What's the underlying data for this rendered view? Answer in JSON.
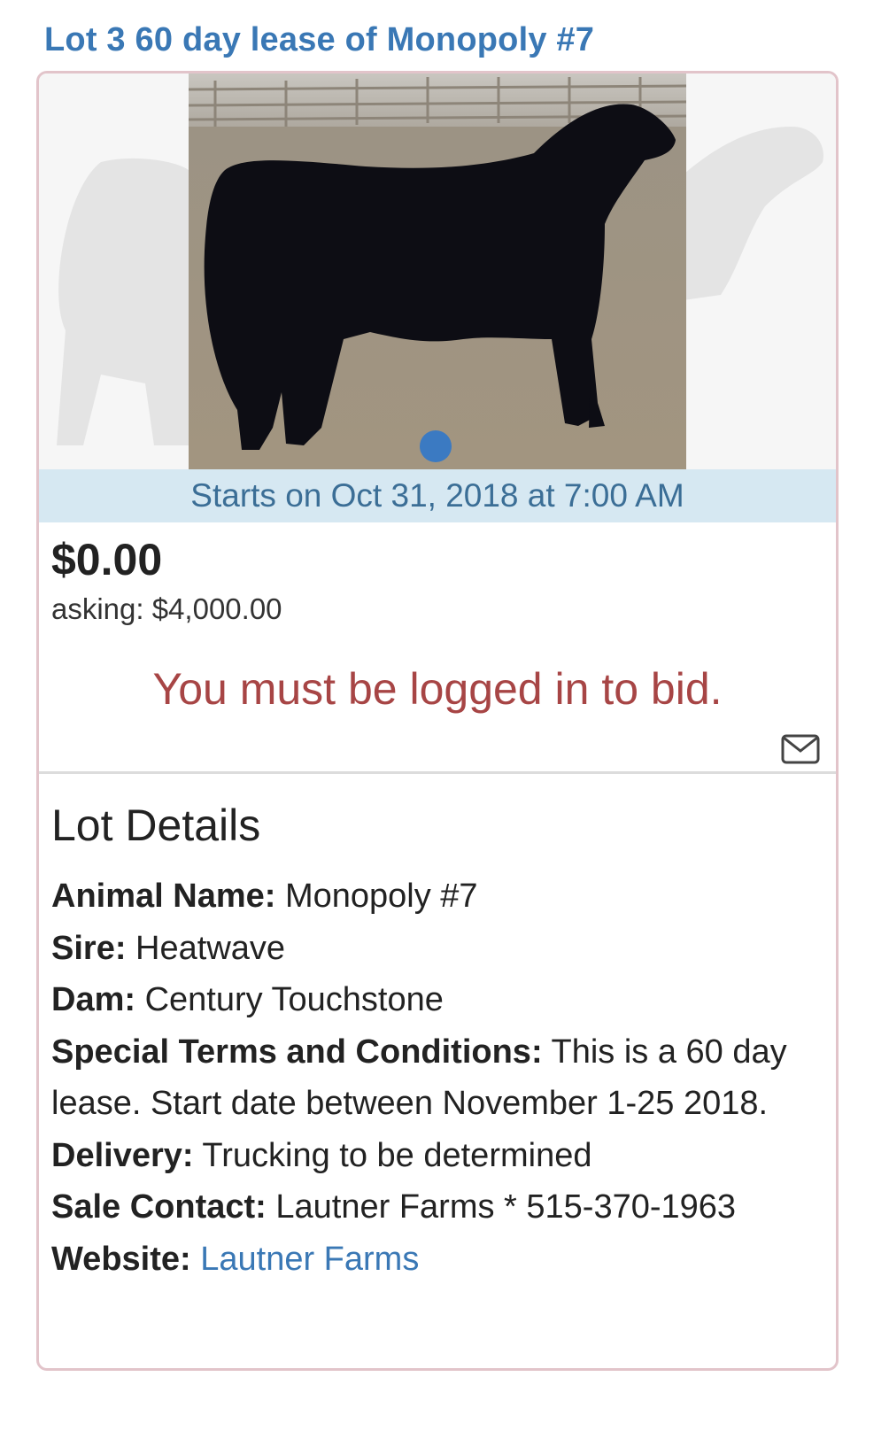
{
  "lot": {
    "title": "Lot 3 60 day lease of Monopoly #7",
    "starts": "Starts on Oct 31, 2018 at 7:00 AM",
    "price": "$0.00",
    "asking": "asking: $4,000.00",
    "login_message": "You must be logged in to bid."
  },
  "details": {
    "heading": "Lot Details",
    "rows": [
      {
        "label": "Animal Name:",
        "value": "Monopoly #7"
      },
      {
        "label": "Sire:",
        "value": "Heatwave"
      },
      {
        "label": "Dam:",
        "value": "Century Touchstone"
      },
      {
        "label": "Special Terms and Conditions:",
        "value": "This is a 60 day lease. Start date between November 1-25 2018."
      },
      {
        "label": "Delivery:",
        "value": "Trucking to be determined"
      },
      {
        "label": "Sale Contact:",
        "value": "Lautner Farms * 515-370-1963"
      },
      {
        "label": "Website:",
        "value": "Lautner Farms"
      }
    ]
  },
  "icons": {
    "mail": "envelope-icon",
    "carousel_dot": "carousel-dot"
  },
  "colors": {
    "title_blue": "#3a78b5",
    "starts_bar_bg": "#d6e8f2",
    "starts_text": "#3b6e96",
    "login_red": "#a74545",
    "card_border": "#e2c4ca",
    "dot_blue": "#3b7ac2"
  }
}
